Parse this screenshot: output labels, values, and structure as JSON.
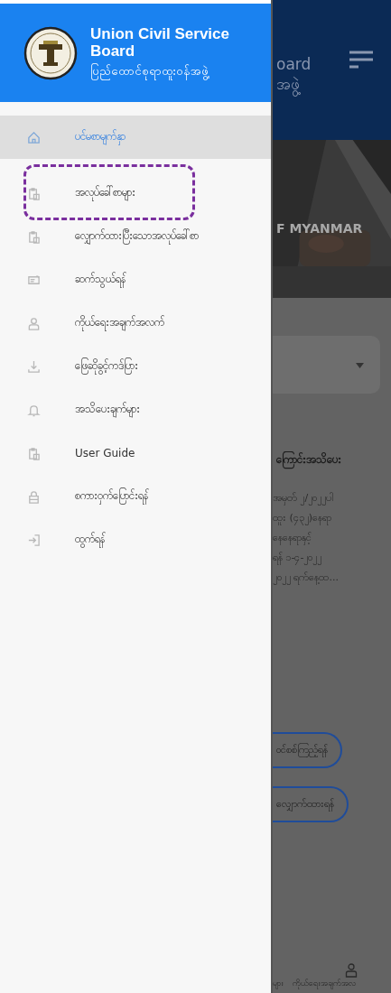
{
  "drawer": {
    "title": "Union Civil Service Board",
    "subtitle": "ပြည်ထောင်စုရာထူးဝန်အဖွဲ့",
    "items": [
      {
        "kind": "home",
        "label": "ပင်မစာမျက်နှာ",
        "selected": true,
        "highlighted": false
      },
      {
        "kind": "clipboard",
        "label": "အလုပ်ခေါ်စာများ",
        "selected": false,
        "highlighted": true
      },
      {
        "kind": "clipboard",
        "label": "လျှောက်ထားပြီးသောအလုပ်ခေါ်စာ",
        "selected": false,
        "highlighted": false
      },
      {
        "kind": "contact",
        "label": "ဆက်သွယ်ရန်",
        "selected": false,
        "highlighted": false
      },
      {
        "kind": "person",
        "label": "ကိုယ်ရေးအချက်အလက်",
        "selected": false,
        "highlighted": false
      },
      {
        "kind": "download",
        "label": "ဖြေဆိုခွင့်ကဒ်ပြား",
        "selected": false,
        "highlighted": false
      },
      {
        "kind": "bell",
        "label": "အသိပေးချက်များ",
        "selected": false,
        "highlighted": false
      },
      {
        "kind": "clipboard",
        "label": "User Guide",
        "selected": false,
        "highlighted": false
      },
      {
        "kind": "lock",
        "label": "စကားဝှက်ပြောင်းရန်",
        "selected": false,
        "highlighted": false
      },
      {
        "kind": "logout",
        "label": "ထွက်ရန်",
        "selected": false,
        "highlighted": false
      }
    ]
  },
  "background": {
    "header_title": [
      "oard",
      "အဖွဲ့"
    ],
    "banner_text": "F MYANMAR",
    "notice_title": "ကြောင်းအသိပေး",
    "notice_lines": [
      "အမှတ် ၂/၂၀၂၂ပါ",
      "ထူး (၄၃၂)နေရာ",
      "နေနေရာနှင့်",
      "ရန် ၁-၄-၂၀၂၂",
      "၂၀၂၂ ရက်နေ့ထ..."
    ],
    "buttons": [
      "ဝင်စစ်ကြည့်ရန်",
      "လျှောက်ထားရန်"
    ],
    "bottom_nav": [
      "များ",
      "ကိုယ်ရေးအချက်အလ"
    ]
  }
}
